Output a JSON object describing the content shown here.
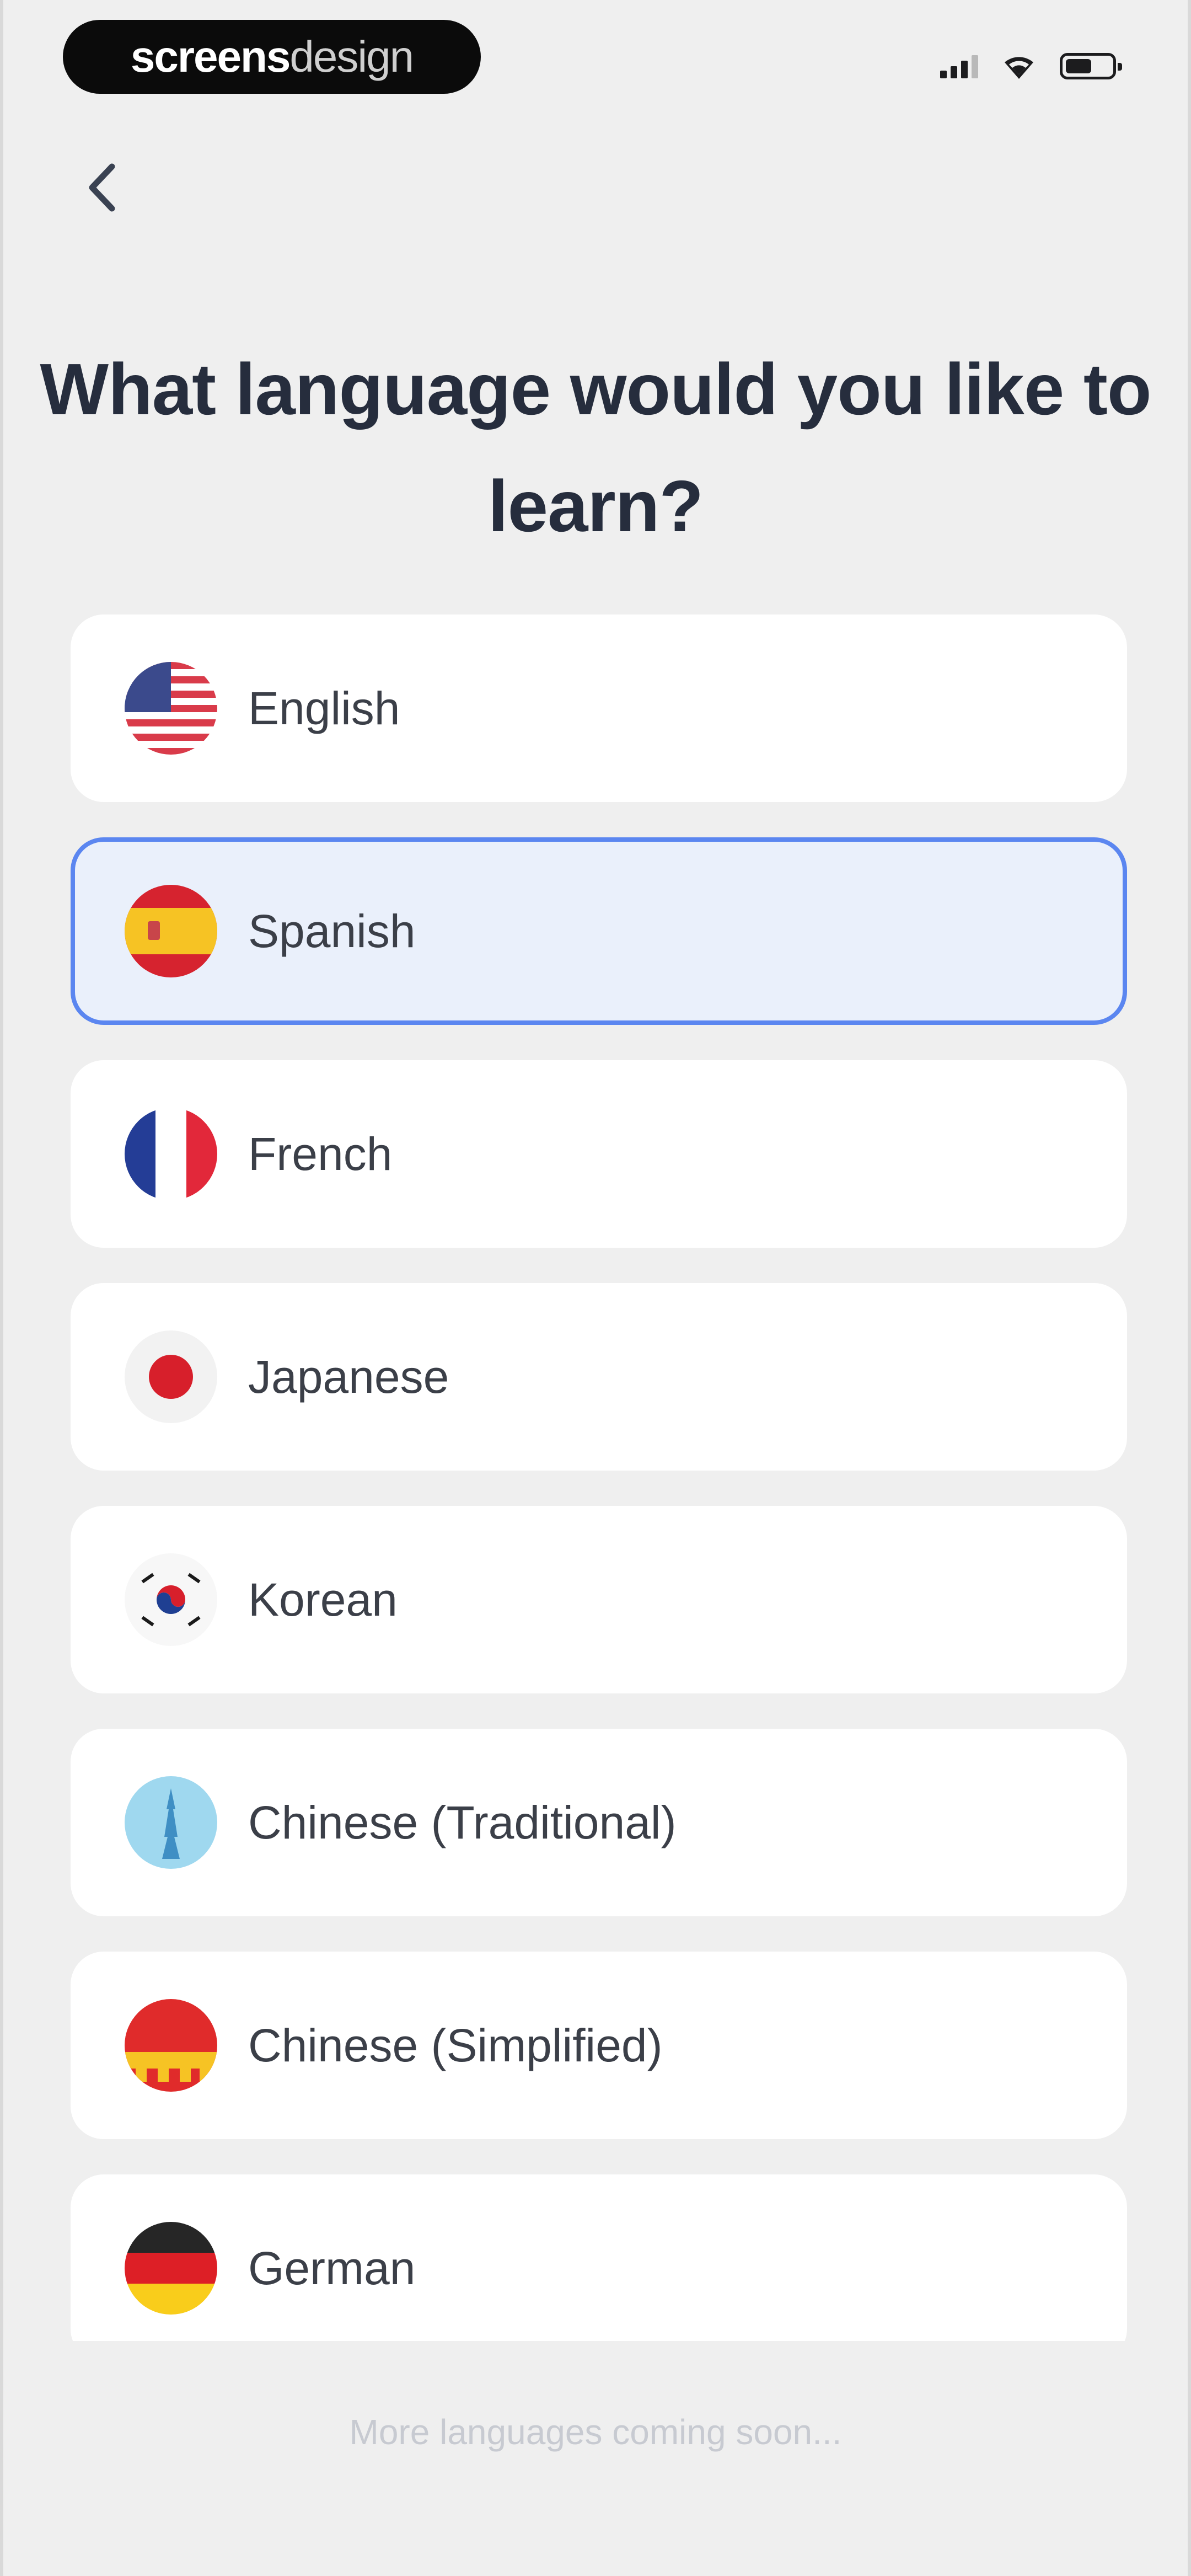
{
  "status_bar": {
    "brand_bold": "screens",
    "brand_light": "design",
    "icons": [
      "signal-icon",
      "wifi-icon",
      "battery-icon"
    ]
  },
  "nav": {
    "back_icon": "chevron-left-icon"
  },
  "title": "What language would you like to learn?",
  "languages": [
    {
      "label": "English",
      "flag": "us-flag-icon",
      "selected": false
    },
    {
      "label": "Spanish",
      "flag": "spain-flag-icon",
      "selected": true
    },
    {
      "label": "French",
      "flag": "france-flag-icon",
      "selected": false
    },
    {
      "label": "Japanese",
      "flag": "japan-flag-icon",
      "selected": false
    },
    {
      "label": "Korean",
      "flag": "korea-flag-icon",
      "selected": false
    },
    {
      "label": "Chinese (Traditional)",
      "flag": "taiwan-landmark-icon",
      "selected": false
    },
    {
      "label": "Chinese (Simplified)",
      "flag": "china-flag-icon",
      "selected": false
    },
    {
      "label": "German",
      "flag": "germany-flag-icon",
      "selected": false
    }
  ],
  "footer_note": "More languages coming soon...",
  "colors": {
    "background": "#efefef",
    "card": "#ffffff",
    "selected_fill": "#eaf0fb",
    "selected_border": "#5b86f0",
    "title": "#262d3d",
    "label": "#3b3f48",
    "footer": "#c7cad1"
  }
}
